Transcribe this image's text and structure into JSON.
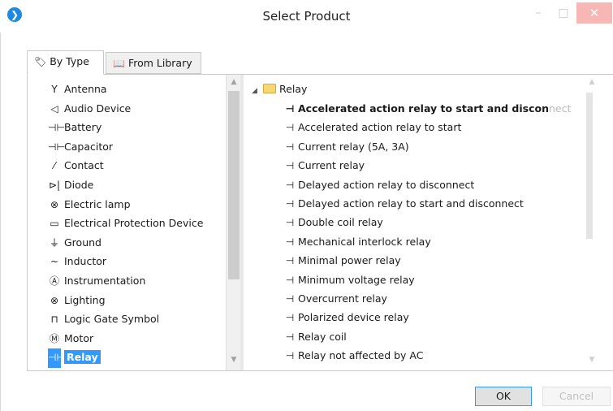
{
  "window": {
    "title": "Select Product",
    "app_icon": "chevron-circle-icon",
    "minimize": "–",
    "maximize": "□",
    "close": "✕"
  },
  "tabs": [
    {
      "label": "By Type",
      "icon": "tag-icon",
      "glyph": "🏷",
      "active": true
    },
    {
      "label": "From Library",
      "icon": "book-icon",
      "glyph": "📖",
      "active": false
    }
  ],
  "types": [
    {
      "label": "Antenna",
      "glyph": "Y"
    },
    {
      "label": "Audio Device",
      "glyph": "◁"
    },
    {
      "label": "Battery",
      "glyph": "⊣⊢"
    },
    {
      "label": "Capacitor",
      "glyph": "⊣⊢"
    },
    {
      "label": "Contact",
      "glyph": "⁄"
    },
    {
      "label": "Diode",
      "glyph": "⊳|"
    },
    {
      "label": "Electric lamp",
      "glyph": "⊗"
    },
    {
      "label": "Electrical Protection Device",
      "glyph": "▭"
    },
    {
      "label": "Ground",
      "glyph": "⏚"
    },
    {
      "label": "Inductor",
      "glyph": "~"
    },
    {
      "label": "Instrumentation",
      "glyph": "Ⓐ"
    },
    {
      "label": "Lighting",
      "glyph": "⊗"
    },
    {
      "label": "Logic Gate Symbol",
      "glyph": "⊓"
    },
    {
      "label": "Motor",
      "glyph": "Ⓜ"
    },
    {
      "label": "Relay",
      "glyph": "⊣⊢",
      "selected": true
    }
  ],
  "tree": {
    "root": "Relay",
    "items": [
      {
        "label": "Accelerated action relay to start and discon",
        "fade": "nect",
        "bold": true
      },
      {
        "label": "Accelerated action relay to start"
      },
      {
        "label": "Current relay (5A, 3A)"
      },
      {
        "label": "Current relay"
      },
      {
        "label": "Delayed action relay to disconnect"
      },
      {
        "label": "Delayed action relay to start and disconnect"
      },
      {
        "label": "Double coil relay"
      },
      {
        "label": "Mechanical interlock relay"
      },
      {
        "label": "Minimal power relay"
      },
      {
        "label": "Minimum voltage relay"
      },
      {
        "label": "Overcurrent relay"
      },
      {
        "label": "Polarized device relay"
      },
      {
        "label": "Relay coil"
      },
      {
        "label": "Relay not affected by AC"
      }
    ]
  },
  "buttons": {
    "ok": "OK",
    "cancel": "Cancel"
  },
  "scroll": {
    "up": "▲",
    "down": "▼"
  }
}
